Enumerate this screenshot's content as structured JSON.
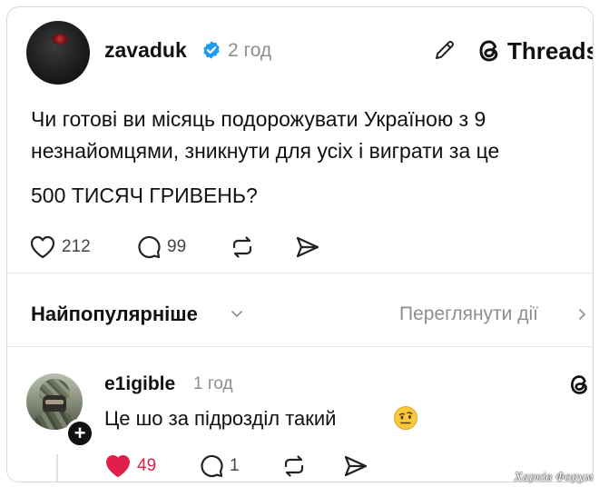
{
  "post": {
    "author": "zavaduk",
    "time": "2 год",
    "brand": "Threads",
    "text_line1": "Чи готові ви місяць подорожувати Україною з 9",
    "text_line2": "незнайомцями, зникнути для усіх і виграти за це",
    "text_line3": "500 ТИСЯЧ ГРИВЕНЬ?",
    "likes": "212",
    "replies": "99"
  },
  "replies_bar": {
    "sort_label": "Найпопулярніше",
    "view_activity": "Переглянути дії"
  },
  "comment": {
    "author": "e1igible",
    "time": "1 год",
    "text": "Це шо за підрозділ такий",
    "likes": "49",
    "replies": "1",
    "liked": true
  },
  "watermark": "Харків Форум",
  "colors": {
    "verified": "#1d9bf0",
    "like_active": "#e0204a",
    "secondary_text": "#8e8e8e"
  },
  "icons": [
    "verified-icon",
    "pencil-icon",
    "threads-logo-icon",
    "heart-icon",
    "comment-icon",
    "repost-icon",
    "share-icon",
    "chevron-down-icon",
    "chevron-right-icon",
    "plus-icon",
    "emoji-icon"
  ]
}
